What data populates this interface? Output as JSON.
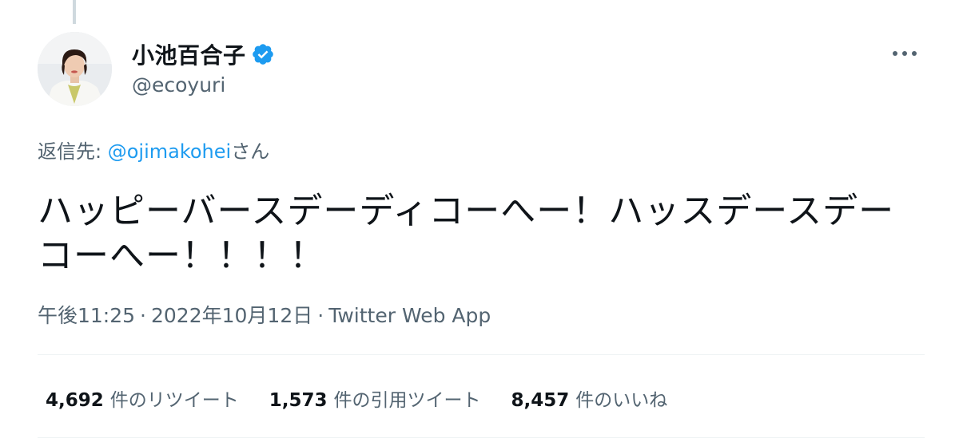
{
  "author": {
    "display_name": "小池百合子",
    "handle": "@ecoyuri",
    "verified": true
  },
  "reply": {
    "prefix": "返信先: ",
    "mention": "@ojimakohei",
    "suffix": "さん"
  },
  "tweet": {
    "text": "ハッピーバースデーディコーへー！ハッスデースデーコーへー！！！！"
  },
  "meta": {
    "time": "午後11:25",
    "separator": "·",
    "date": "2022年10月12日",
    "source": "Twitter Web App"
  },
  "stats": [
    {
      "count": "4,692",
      "label": "件のリツイート"
    },
    {
      "count": "1,573",
      "label": "件の引用ツイート"
    },
    {
      "count": "8,457",
      "label": "件のいいね"
    }
  ],
  "colors": {
    "verified": "#1d9bf0",
    "link": "#1d9bf0",
    "secondary_text": "#536471",
    "primary_text": "#0f1419"
  },
  "icons": {
    "verified": "verified-badge-icon",
    "more": "more-dots-icon"
  }
}
